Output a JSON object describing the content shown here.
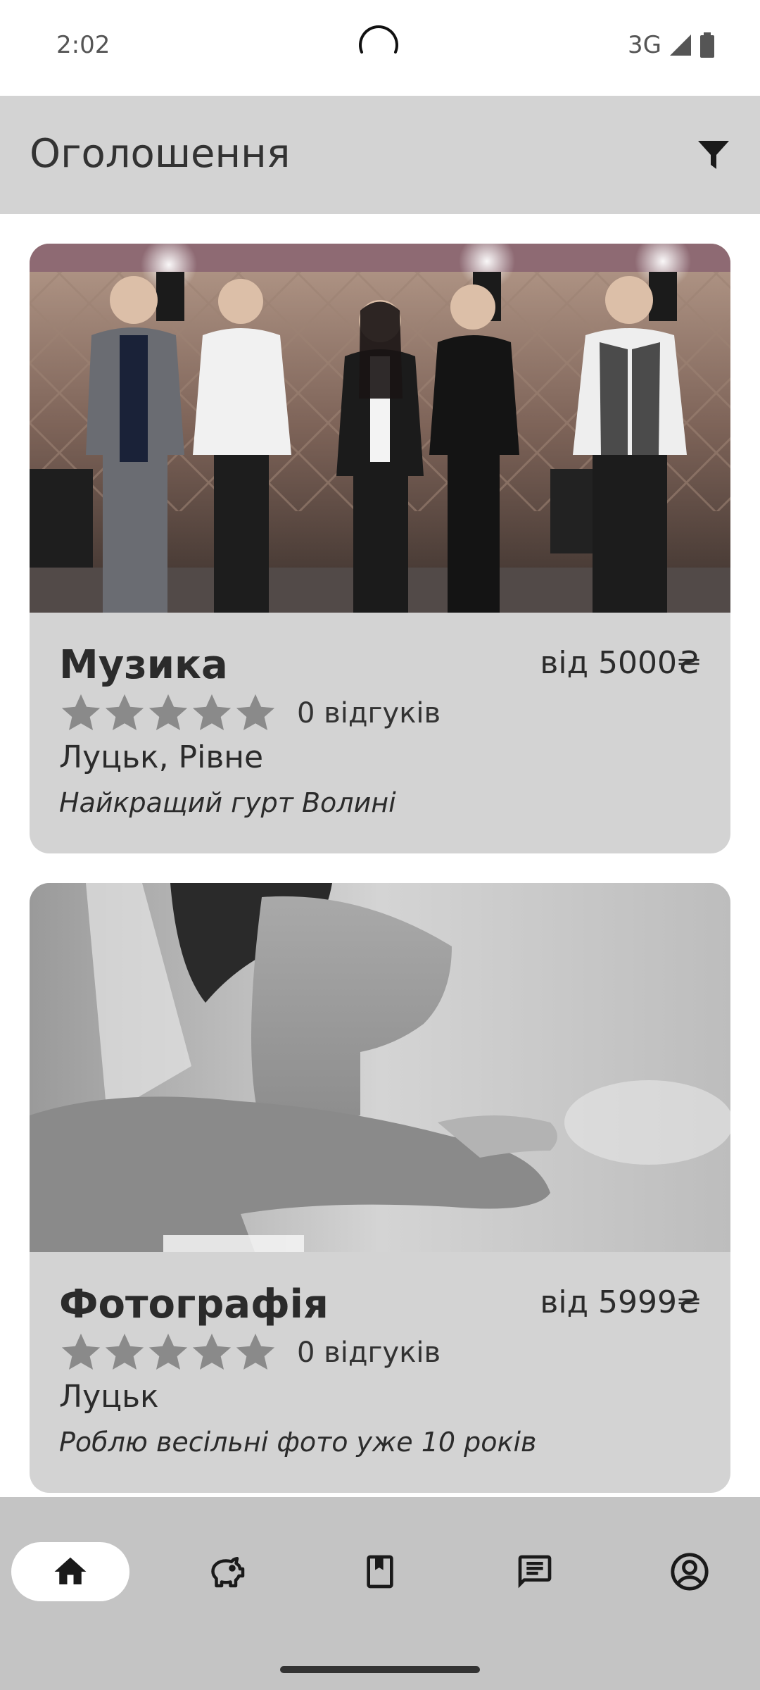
{
  "status_bar": {
    "time": "2:02",
    "network": "3G"
  },
  "app_bar": {
    "title": "Оголошення",
    "filter_icon": "filter-icon"
  },
  "listings": [
    {
      "category": "Музика",
      "price": "від 5000₴",
      "rating": 0,
      "reviews": "0 відгуків",
      "location": "Луцьк, Рівне",
      "description": "Найкращий гурт Волині",
      "image": "band-photo"
    },
    {
      "category": "Фотографія",
      "price": "від 5999₴",
      "rating": 0,
      "reviews": "0 відгуків",
      "location": "Луцьк",
      "description": "Роблю весільні фото уже 10 років",
      "image": "bride-photo"
    }
  ],
  "bottom_nav": {
    "items": [
      {
        "icon": "home-icon",
        "active": true
      },
      {
        "icon": "piggy-bank-icon",
        "active": false
      },
      {
        "icon": "bookmark-book-icon",
        "active": false
      },
      {
        "icon": "chat-icon",
        "active": false
      },
      {
        "icon": "account-icon",
        "active": false
      }
    ]
  },
  "colors": {
    "app_bar": "#d3d3d3",
    "card": "#d3d3d3",
    "nav_bar": "#c4c4c4",
    "star": "#8a8a8a",
    "nav_active": "#ffffff"
  }
}
